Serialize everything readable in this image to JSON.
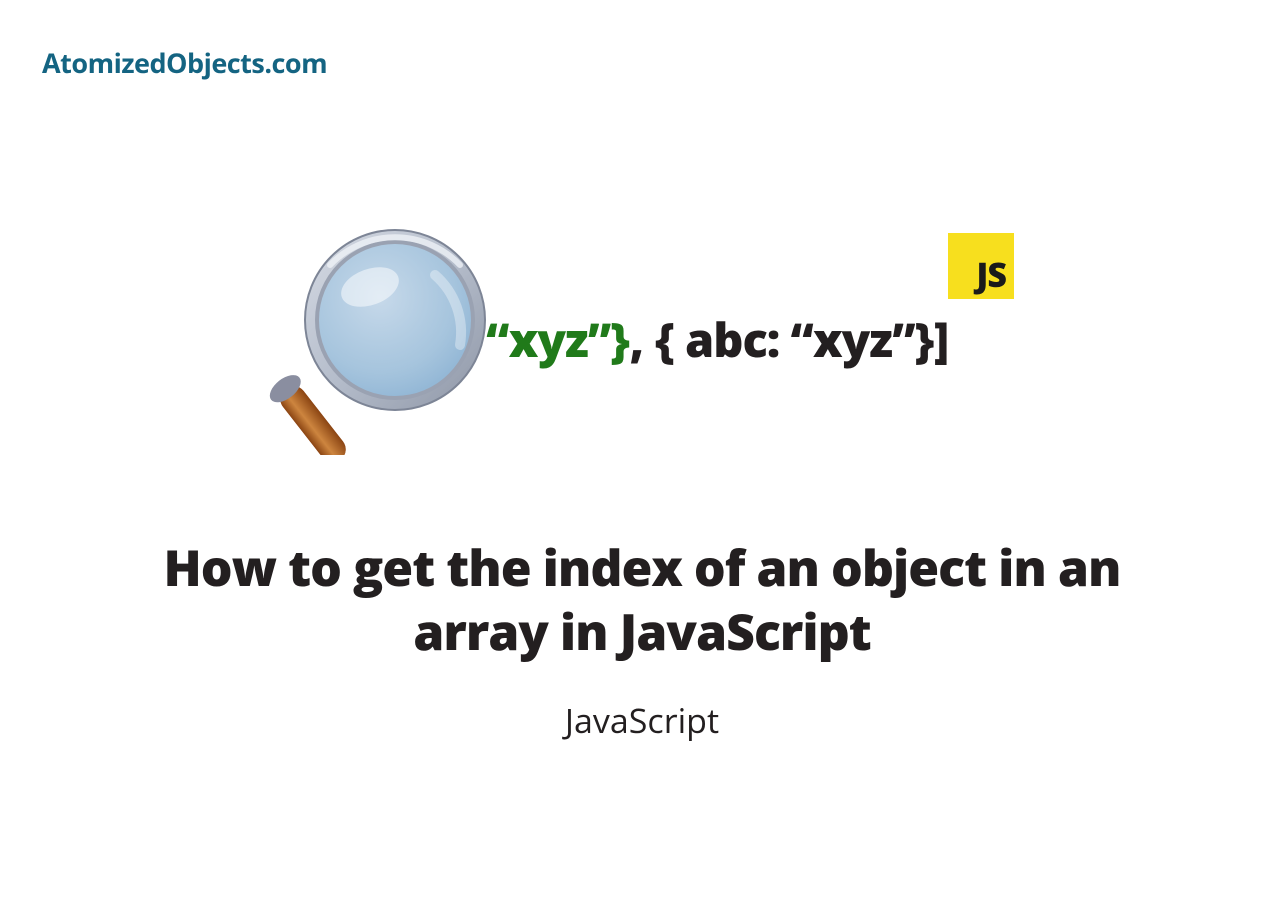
{
  "site": {
    "name": "AtomizedObjects.com"
  },
  "badge": {
    "label": "JS"
  },
  "code": {
    "open_bracket": "[",
    "highlighted": "{ abc: “xyz”}",
    "separator": ", ",
    "normal": "{ abc: “xyz”}",
    "close_bracket": "]"
  },
  "article": {
    "title": "How to get the index of an object in an array in JavaScript",
    "category": "JavaScript"
  },
  "colors": {
    "brand": "#146482",
    "badge_bg": "#f7df1e",
    "code_highlight": "#207a1a",
    "text": "#231f20"
  }
}
